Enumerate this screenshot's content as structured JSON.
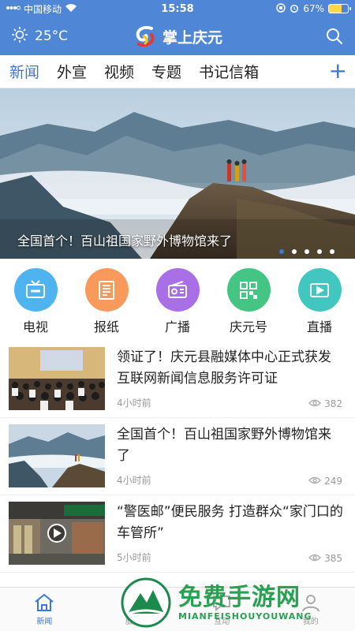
{
  "status_bar": {
    "carrier": "中国移动",
    "time": "15:58",
    "battery": "67%",
    "battery_level": 0.67
  },
  "header": {
    "temperature": "25°C",
    "app_name": "掌上庆元"
  },
  "tabs": [
    {
      "label": "新闻",
      "active": true
    },
    {
      "label": "外宣"
    },
    {
      "label": "视频"
    },
    {
      "label": "专题"
    },
    {
      "label": "书记信箱"
    }
  ],
  "banner": {
    "caption": "全国首个！百山祖国家野外博物馆来了",
    "slide_count": 5,
    "active_slide": 1
  },
  "channels": [
    {
      "label": "电视",
      "icon": "tv-icon",
      "color": "#4fb3ef"
    },
    {
      "label": "报纸",
      "icon": "newspaper-icon",
      "color": "#f79a5c"
    },
    {
      "label": "广播",
      "icon": "radio-icon",
      "color": "#a86fe6"
    },
    {
      "label": "庆元号",
      "icon": "qrcode-icon",
      "color": "#44c584"
    },
    {
      "label": "直播",
      "icon": "live-video-icon",
      "color": "#41c7bf"
    }
  ],
  "news": [
    {
      "title": "领证了！庆元县融媒体中心正式获发互联网新闻信息服务许可证",
      "time": "4小时前",
      "views": "382"
    },
    {
      "title": "全国首个！百山祖国家野外博物馆来了",
      "time": "4小时前",
      "views": "249"
    },
    {
      "title": "“警医邮”便民服务 打造群众“家门口的车管所”",
      "time": "5小时前",
      "views": "385",
      "video": true
    }
  ],
  "bottom_nav": [
    {
      "label": "新闻",
      "active": true
    },
    {
      "label": "服务"
    },
    {
      "label": "互动"
    },
    {
      "label": "我的"
    }
  ],
  "watermark": {
    "title": "免费手游网",
    "url": "MIANFEISHOUYOUWANG"
  },
  "colors": {
    "brand": "#4f86d6",
    "accent": "#3b78d6"
  }
}
